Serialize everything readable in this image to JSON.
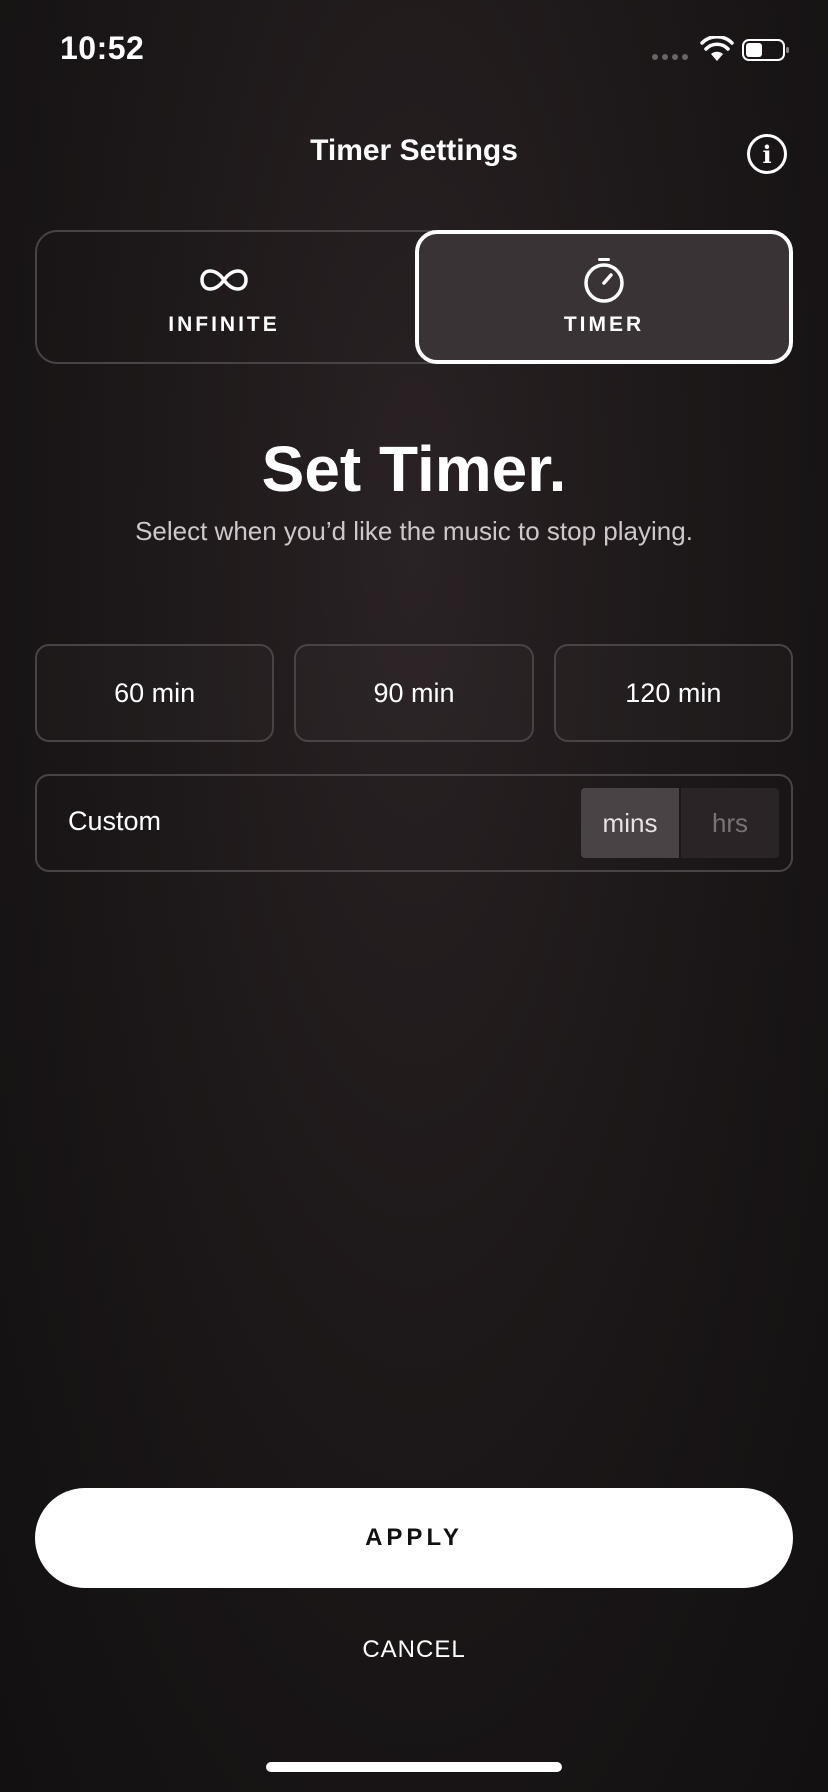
{
  "status_bar": {
    "time": "10:52",
    "icons": [
      "signal-dots-icon",
      "wifi-icon",
      "battery-icon"
    ]
  },
  "header": {
    "title": "Timer Settings",
    "info_icon": "info-icon",
    "info_glyph": "i"
  },
  "mode_toggle": {
    "options": [
      {
        "label": "INFINITE",
        "icon": "infinity-icon",
        "selected": false
      },
      {
        "label": "TIMER",
        "icon": "stopwatch-icon",
        "selected": true
      }
    ]
  },
  "main": {
    "heading": "Set Timer.",
    "subheading": "Select when you’d like the music to stop playing."
  },
  "presets": [
    "60 min",
    "90 min",
    "120 min"
  ],
  "custom": {
    "label": "Custom",
    "units": [
      {
        "label": "mins",
        "selected": true
      },
      {
        "label": "hrs",
        "selected": false
      }
    ]
  },
  "actions": {
    "apply_label": "APPLY",
    "cancel_label": "CANCEL"
  },
  "colors": {
    "background": "#1d1819",
    "accent": "#ffffff",
    "border": "#4a4345",
    "selected_fill": "#3a3335"
  }
}
